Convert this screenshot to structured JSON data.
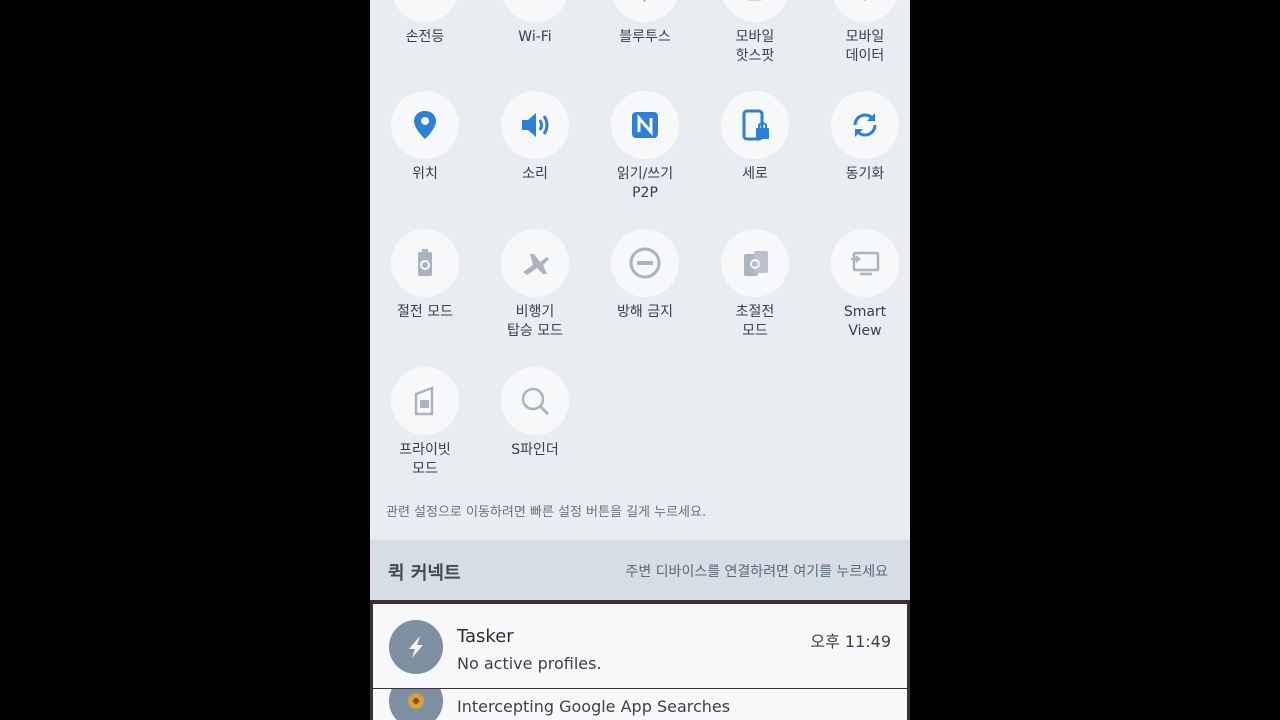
{
  "colors": {
    "accent": "#2f7fd6",
    "muted_icon": "#a9b4bf",
    "panel": "#e9edf1",
    "tile": "#f7f8fa"
  },
  "tiles": [
    {
      "label": "손전등",
      "icon": "flashlight-icon"
    },
    {
      "label": "Wi-Fi",
      "icon": "wifi-icon"
    },
    {
      "label": "블루투스",
      "icon": "bluetooth-icon"
    },
    {
      "label": "모바일\n핫스팟",
      "icon": "hotspot-icon"
    },
    {
      "label": "모바일\n데이터",
      "icon": "mobile-data-icon"
    },
    {
      "label": "위치",
      "icon": "location-pin-icon"
    },
    {
      "label": "소리",
      "icon": "speaker-icon"
    },
    {
      "label": "읽기/쓰기\nP2P",
      "icon": "nfc-icon"
    },
    {
      "label": "세로",
      "icon": "portrait-lock-icon"
    },
    {
      "label": "동기화",
      "icon": "sync-icon"
    },
    {
      "label": "절전 모드",
      "icon": "power-saving-icon"
    },
    {
      "label": "비행기\n탑승 모드",
      "icon": "airplane-icon"
    },
    {
      "label": "방해 금지",
      "icon": "do-not-disturb-icon"
    },
    {
      "label": "초절전\n모드",
      "icon": "ultra-power-saving-icon"
    },
    {
      "label": "Smart\nView",
      "icon": "smart-view-icon"
    },
    {
      "label": "프라이빗\n모드",
      "icon": "private-mode-icon"
    },
    {
      "label": "S파인더",
      "icon": "magnifier-icon"
    }
  ],
  "hint": "관련 설정으로 이동하려면 빠른 설정 버튼을 길게 누르세요.",
  "quick_connect": {
    "title": "퀵 커넥트",
    "description": "주변 디바이스를 연결하려면 여기를 누르세요"
  },
  "notifications": [
    {
      "app": "Tasker",
      "text": "No active profiles.",
      "time": "오후 11:49",
      "icon": "lightning-icon"
    },
    {
      "text": "Intercepting Google App Searches",
      "icon": "app-icon"
    }
  ]
}
